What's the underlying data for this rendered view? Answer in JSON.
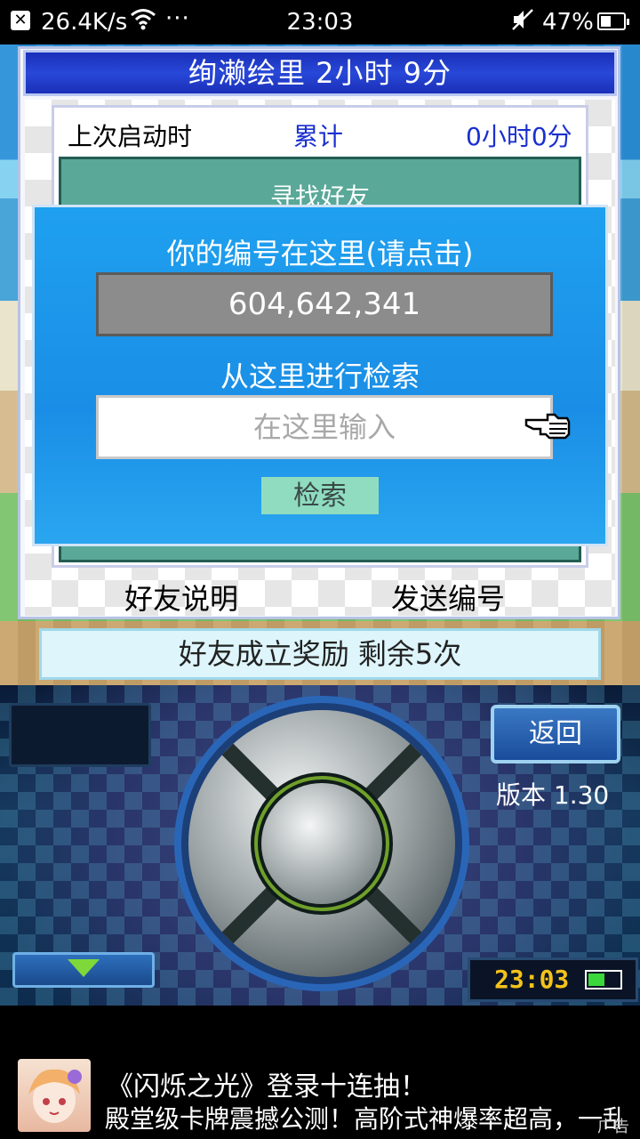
{
  "status_bar": {
    "network_speed": "26.4K/s",
    "dots": "···",
    "time": "23:03",
    "battery_pct": "47%"
  },
  "dialog": {
    "header": "绚濑绘里  2小时 9分",
    "last_launch_label": "上次启动时",
    "total_label": "累计",
    "total_time": "0小时0分",
    "find_friend_title": "寻找好友",
    "friend_desc": "好友说明",
    "send_id": "发送编号",
    "reward": "好友成立奖励  剩余5次"
  },
  "popup": {
    "title": "你的编号在这里(请点击)",
    "user_id": "604,642,341",
    "search_title": "从这里进行检索",
    "search_placeholder": "在这里输入",
    "search_button": "检索"
  },
  "controller": {
    "back_button": "返回",
    "version": "版本 1.30",
    "clock": "23:03"
  },
  "ad": {
    "title": "《闪烁之光》登录十连抽！",
    "text": "殿堂级卡牌震撼公测！高阶式神爆率超高，一乱",
    "tag": "广告"
  },
  "colors": {
    "header_blue": "#1a2fb8",
    "popup_blue": "#1a8ee6",
    "panel_green": "#5aa898",
    "search_button": "#8fdcc0",
    "clock_gold": "#f4c21a"
  },
  "icons": [
    "close-icon",
    "wifi-icon",
    "mute-icon",
    "battery-icon",
    "pointer-hand-icon",
    "down-arrow-icon",
    "dpad-icon"
  ]
}
